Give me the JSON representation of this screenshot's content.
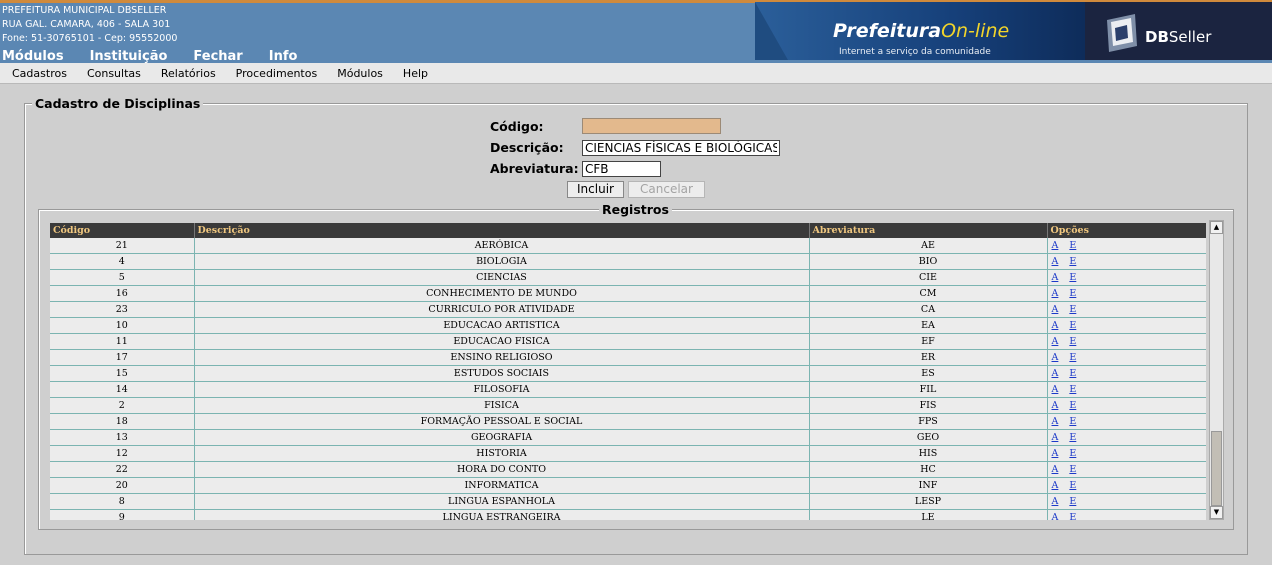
{
  "header": {
    "org_lines": [
      "PREFEITURA MUNICIPAL DBSELLER",
      "RUA GAL. CAMARA, 406 - SALA 301",
      "Fone: 51-30765101  -  Cep: 95552000"
    ],
    "top_menu": [
      "Módulos",
      "Instituição",
      "Fechar",
      "Info"
    ],
    "brand_title_main": "Prefeitura",
    "brand_title_accent": "On-line",
    "brand_subtitle": "Internet a serviço da comunidade",
    "vendor_logo_prefix": "DB",
    "vendor_logo_suffix": "Seller"
  },
  "menubar": [
    "Cadastros",
    "Consultas",
    "Relatórios",
    "Procedimentos",
    "Módulos",
    "Help"
  ],
  "form": {
    "legend": "Cadastro de Disciplinas",
    "codigo_label": "Código:",
    "codigo_value": "",
    "descricao_label": "Descrição:",
    "descricao_value": "CIENCIAS FÍSICAS E BIOLÓGICAS",
    "abreviatura_label": "Abreviatura:",
    "abreviatura_value": "CFB",
    "incluir_label": "Incluir",
    "cancelar_label": "Cancelar"
  },
  "registros": {
    "legend": "Registros",
    "columns": [
      "Código",
      "Descrição",
      "Abreviatura",
      "Opções"
    ],
    "option_alter": "A",
    "option_exclude": "E",
    "rows": [
      [
        "21",
        "AERÓBICA",
        "AE"
      ],
      [
        "4",
        "BIOLOGIA",
        "BIO"
      ],
      [
        "5",
        "CIENCIAS",
        "CIE"
      ],
      [
        "16",
        "CONHECIMENTO DE MUNDO",
        "CM"
      ],
      [
        "23",
        "CURRICULO POR ATIVIDADE",
        "CA"
      ],
      [
        "10",
        "EDUCACAO ARTISTICA",
        "EA"
      ],
      [
        "11",
        "EDUCACAO FISICA",
        "EF"
      ],
      [
        "17",
        "ENSINO RELIGIOSO",
        "ER"
      ],
      [
        "15",
        "ESTUDOS SOCIAIS",
        "ES"
      ],
      [
        "14",
        "FILOSOFIA",
        "FIL"
      ],
      [
        "2",
        "FISICA",
        "FIS"
      ],
      [
        "18",
        "FORMAÇÃO PESSOAL E SOCIAL",
        "FPS"
      ],
      [
        "13",
        "GEOGRAFIA",
        "GEO"
      ],
      [
        "12",
        "HISTORIA",
        "HIS"
      ],
      [
        "22",
        "HORA DO CONTO",
        "HC"
      ],
      [
        "20",
        "INFORMATICA",
        "INF"
      ],
      [
        "8",
        "LINGUA ESPANHOLA",
        "LESP"
      ],
      [
        "9",
        "LINGUA ESTRANGEIRA",
        "LE"
      ]
    ]
  },
  "colors": {
    "header_bg": "#5b87b3",
    "header_accent": "#d08a3c",
    "grid_header_bg": "#3a3a3a",
    "grid_header_text": "#f0c77f",
    "codigo_field_bg": "#e3b98d",
    "link": "#1c39c9"
  }
}
